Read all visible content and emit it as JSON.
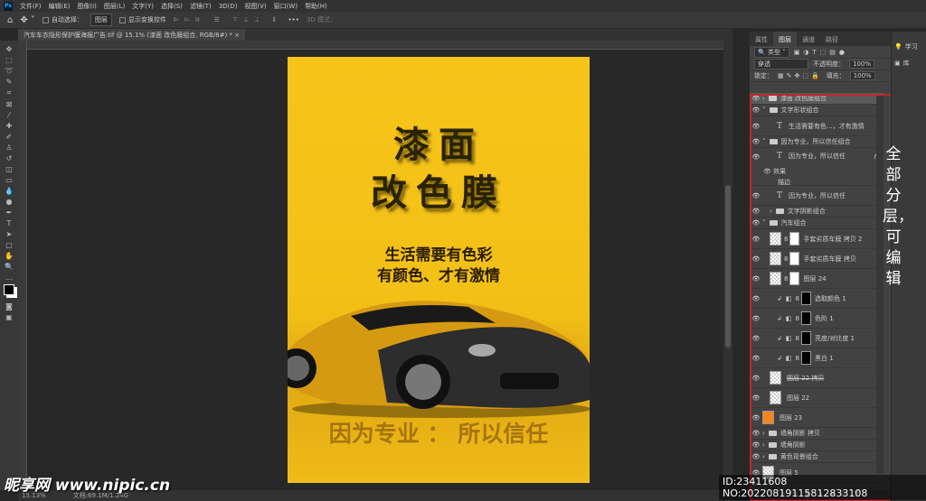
{
  "menu": {
    "app_logo": "Ps",
    "items": [
      "文件(F)",
      "编辑(E)",
      "图像(I)",
      "图层(L)",
      "文字(Y)",
      "选择(S)",
      "滤镜(T)",
      "3D(D)",
      "视图(V)",
      "窗口(W)",
      "帮助(H)"
    ]
  },
  "options": {
    "auto_select_label": "自动选择：",
    "auto_select_value": "图层",
    "show_transform_label": "显示变换控件",
    "mode_3d": "3D 模式："
  },
  "document": {
    "tab_title": "汽车车衣隐形保护膜海报广告.tif @ 15.1% (漆面 改色膜组合, RGB/8#) *",
    "close": "×"
  },
  "poster": {
    "title_line1": "漆面",
    "title_line2": "改色膜",
    "slogan_line1": "生活需要有色彩",
    "slogan_line2": "有颜色、才有激情",
    "bottom_slogan": "因为专业 ： 所以信任"
  },
  "panels": {
    "tabs": [
      "属性",
      "图层",
      "通道",
      "路径"
    ],
    "active_tab": "图层",
    "filter_label": "类型",
    "blend_mode": "穿透",
    "opacity_label": "不透明度：",
    "opacity_value": "100%",
    "lock_label": "锁定：",
    "fill_label": "填充：",
    "fill_value": "100%"
  },
  "layers": [
    {
      "name": "漆面 改色膜组合",
      "type": "group",
      "collapsed": true,
      "selected": true
    },
    {
      "name": "文字形状组合",
      "type": "group",
      "collapsed": false
    },
    {
      "name": "生活需要有色...，才有激情",
      "type": "text",
      "indent": 1
    },
    {
      "name": "因为专业，所以信任组合",
      "type": "group",
      "collapsed": false
    },
    {
      "name": "因为专业，所以信任",
      "type": "text",
      "indent": 1,
      "fx": "fx",
      "effects_label": "效果",
      "effect": "描边"
    },
    {
      "name": "因为专业，所以信任",
      "type": "text",
      "indent": 1
    },
    {
      "name": "文字阴影组合",
      "type": "group",
      "collapsed": true,
      "indent": 1
    },
    {
      "name": "汽车组合",
      "type": "group",
      "collapsed": false
    },
    {
      "name": "手套劣质车膜 拷贝 2",
      "type": "masked",
      "indent": 1
    },
    {
      "name": "手套劣质车膜 拷贝",
      "type": "masked",
      "indent": 1
    },
    {
      "name": "图层 24",
      "type": "masked",
      "indent": 1
    },
    {
      "name": "选取颜色 1",
      "type": "adjust",
      "indent": 2,
      "icon": "selective-color-icon"
    },
    {
      "name": "色阶 1",
      "type": "adjust",
      "indent": 2,
      "icon": "levels-icon"
    },
    {
      "name": "亮度/对比度 1",
      "type": "adjust",
      "indent": 2,
      "icon": "brightness-icon"
    },
    {
      "name": "黑白 1",
      "type": "adjust",
      "indent": 2,
      "icon": "black-white-icon"
    },
    {
      "name": "图层 22 拷贝",
      "type": "pixel",
      "indent": 1,
      "hidden_style": "strikethrough"
    },
    {
      "name": "图层 22",
      "type": "pixel",
      "indent": 1
    },
    {
      "name": "图层 23",
      "type": "fill",
      "color": "#f7841c"
    },
    {
      "name": "墙角阴影 拷贝",
      "type": "group",
      "collapsed": true
    },
    {
      "name": "墙角阴影",
      "type": "group",
      "collapsed": true
    },
    {
      "name": "黄色背景组合",
      "type": "group",
      "collapsed": true
    },
    {
      "name": "图层 5",
      "type": "pixel"
    }
  ],
  "far_right": {
    "learn": "学习",
    "library": "库"
  },
  "annotation": "全部分层，可编辑",
  "status": {
    "zoom": "15.13%",
    "doc": "文档:69.1M/1.24G"
  },
  "watermark": {
    "site": "昵享网 www.nipic.cn",
    "id": "ID:23411608 NO:20220819115812833108"
  },
  "colors": {
    "poster_yellow": "#f7c51a",
    "highlight_red": "#c0282a",
    "accent_orange": "#f7841c"
  }
}
